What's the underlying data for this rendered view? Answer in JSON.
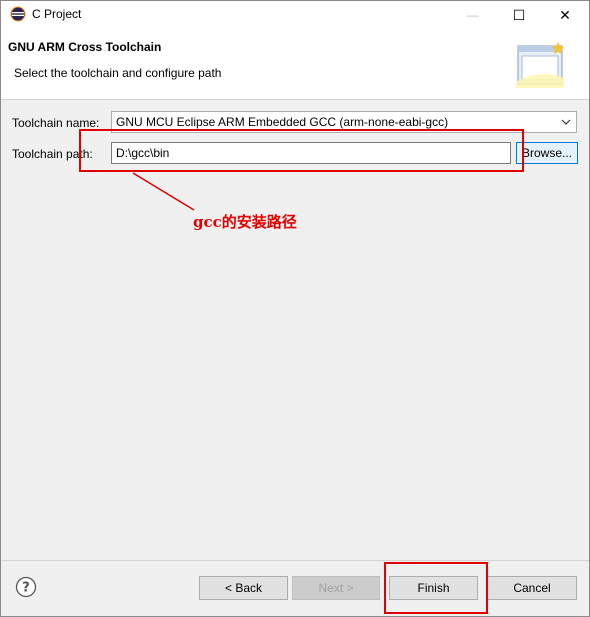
{
  "window": {
    "title": "C Project",
    "controls": {
      "minimize": "—",
      "maximize": "☐",
      "close": "✕"
    }
  },
  "header": {
    "title": "GNU ARM Cross Toolchain",
    "description": "Select the toolchain and configure path"
  },
  "form": {
    "toolchain_name": {
      "label": "Toolchain name:",
      "value": "GNU MCU Eclipse ARM Embedded GCC (arm-none-eabi-gcc)"
    },
    "toolchain_path": {
      "label": "Toolchain path:",
      "value": "D:\\gcc\\bin"
    },
    "browse_label": "Browse..."
  },
  "annotation": {
    "text": "gcc的安装路径",
    "color": "#e00000"
  },
  "footer": {
    "help_label": "?",
    "back_label": "< Back",
    "next_label": "Next >",
    "finish_label": "Finish",
    "cancel_label": "Cancel"
  },
  "icons": [
    "eclipse-icon",
    "wizard-banner-icon",
    "chevron-down-icon",
    "help-icon"
  ]
}
